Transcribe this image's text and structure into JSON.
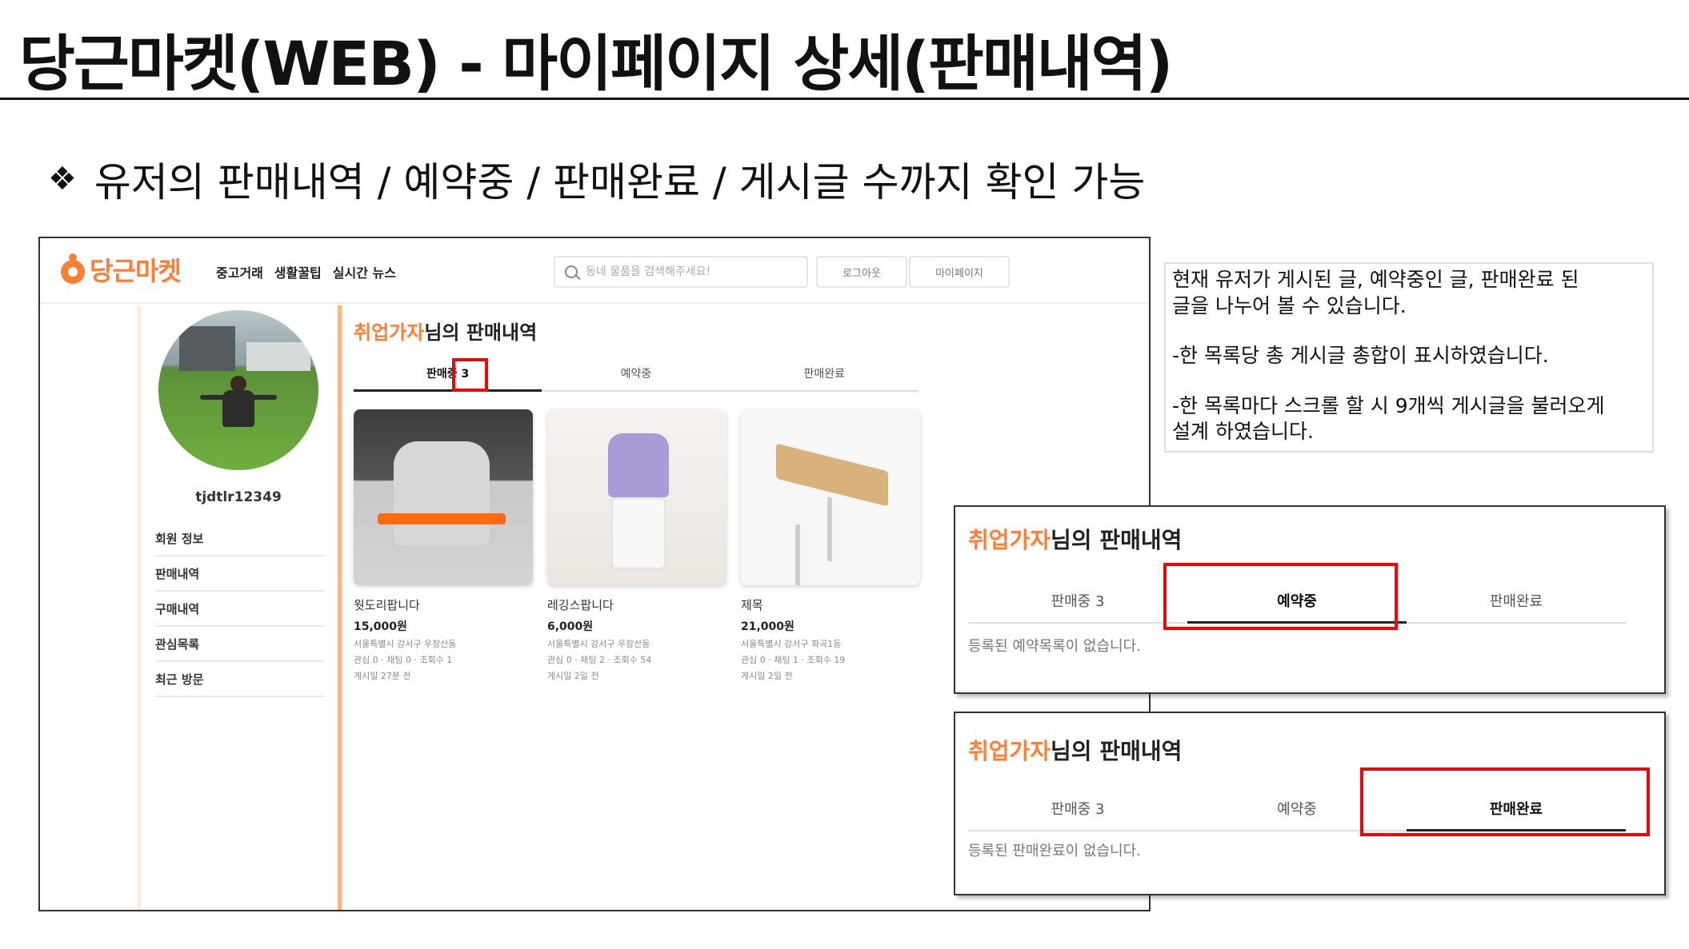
{
  "slide": {
    "title": "당근마켓(WEB) - 마이페이지 상세(판매내역)",
    "bullet_icon": "❖",
    "bullet": "유저의 판매내역 / 예약중 / 판매완료 / 게시글 수까지 확인 가능"
  },
  "header": {
    "logo": "당근마켓",
    "nav": [
      "중고거래",
      "생활꿀팁",
      "실시간 뉴스"
    ],
    "search_placeholder": "동네 물품을 검색해주세요!",
    "logout": "로그아웃",
    "mypage": "마이페이지"
  },
  "profile": {
    "username": "tjdtlr12349",
    "menu": [
      "회원 정보",
      "판매내역",
      "구매내역",
      "관심목록",
      "최근 방문"
    ]
  },
  "sales": {
    "nickname": "취업가자",
    "title_suffix": "님의 판매내역",
    "tabs": [
      "판매중 3",
      "예약중",
      "판매완료"
    ]
  },
  "products": [
    {
      "title": "웟도리팝니다",
      "price": "15,000원",
      "location": "서울특별시 강서구 우장산동",
      "stats": "관심 0 · 채팅 0 · 조회수 1",
      "time": "게시일 27분 전"
    },
    {
      "title": "레깅스팝니다",
      "price": "6,000원",
      "location": "서울특별시 강서구 우장산동",
      "stats": "관심 0 · 채팅 2 · 조회수 54",
      "time": "게시일 2일 전"
    },
    {
      "title": "제목",
      "price": "21,000원",
      "location": "서울특별시 강서구 화곡1동",
      "stats": "관심 0 · 채팅 1 · 조회수 19",
      "time": "게시일 2일 전"
    }
  ],
  "note": {
    "line1": "현재 유저가 게시된 글, 예약중인 글, 판매완료 된",
    "line2": " 글을 나누어 볼 수 있습니다.",
    "line3": "-한 목록당 총 게시글 총합이 표시하였습니다.",
    "line4": "-한 목록마다 스크롤 할 시 9개씩 게시글을 불러오게",
    "line5": "설계 하였습니다."
  },
  "panel_reserved": {
    "nickname": "취업가자",
    "title_suffix": "님의 판매내역",
    "tabs": [
      "판매중 3",
      "예약중",
      "판매완료"
    ],
    "empty": "등록된 예약목록이 없습니다."
  },
  "panel_completed": {
    "nickname": "취업가자",
    "title_suffix": "님의 판매내역",
    "tabs": [
      "판매중 3",
      "예약중",
      "판매완료"
    ],
    "empty": "등록된 판매완료이 없습니다."
  },
  "colors": {
    "brand": "#ff7e36",
    "highlight": "#e80a0a"
  }
}
